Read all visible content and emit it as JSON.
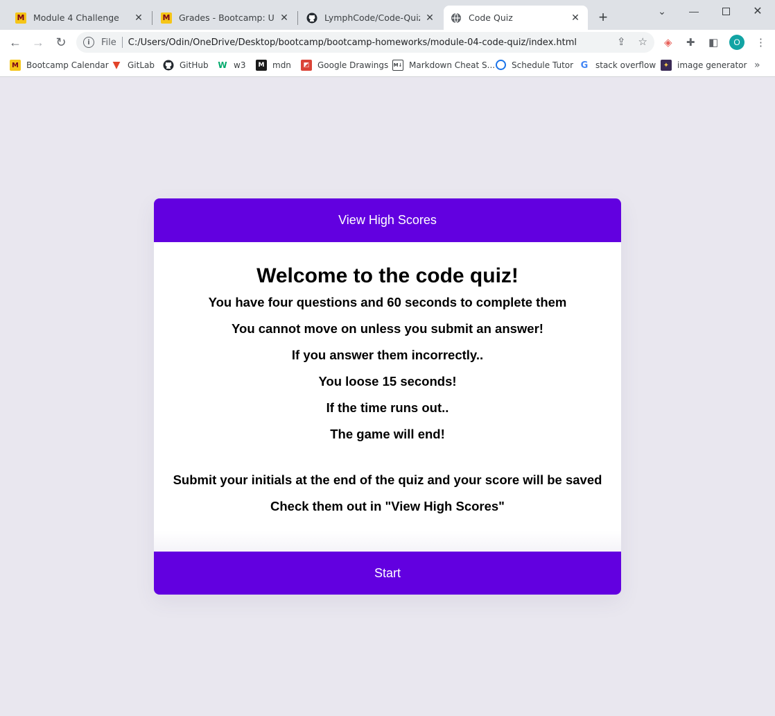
{
  "browser": {
    "tabs": [
      {
        "title": "Module 4 Challenge",
        "favicon": "umn-m-icon"
      },
      {
        "title": "Grades - Bootcamp: UofM-V",
        "favicon": "umn-m-icon"
      },
      {
        "title": "LymphCode/Code-Quiz",
        "favicon": "github-icon"
      },
      {
        "title": "Code Quiz",
        "favicon": "globe-icon"
      }
    ],
    "new_tab_label": "+",
    "address": {
      "scheme_label": "File",
      "url": "C:/Users/Odin/OneDrive/Desktop/bootcamp/bootcamp-homeworks/module-04-code-quiz/index.html"
    },
    "profile_initial": "O",
    "bookmarks": [
      {
        "label": "Bootcamp Calendar",
        "icon": "umn-m-icon"
      },
      {
        "label": "GitLab",
        "icon": "gitlab-icon"
      },
      {
        "label": "GitHub",
        "icon": "github-icon"
      },
      {
        "label": "w3",
        "icon": "w3-icon"
      },
      {
        "label": "mdn",
        "icon": "mdn-icon"
      },
      {
        "label": "Google Drawings",
        "icon": "google-drawings-icon"
      },
      {
        "label": "Markdown Cheat S...",
        "icon": "markdown-icon"
      },
      {
        "label": "Schedule Tutor",
        "icon": "schedule-icon"
      },
      {
        "label": "stack overflow",
        "icon": "google-icon"
      },
      {
        "label": "image generator",
        "icon": "image-gen-icon"
      }
    ],
    "colors": {
      "tab_strip": "#dee1e6",
      "toolbar": "#ffffff",
      "profile": "#12a4a4"
    }
  },
  "quiz": {
    "header_button": "View High Scores",
    "title": "Welcome to the code quiz!",
    "lines": [
      "You have four questions and 60 seconds to complete them",
      "You cannot move on unless you submit an answer!",
      "If you answer them incorrectly..",
      "You loose 15 seconds!",
      "If the time runs out..",
      "The game will end!"
    ],
    "footer_lines": [
      "Submit your initials at the end of the quiz and your score will be saved",
      "Check them out in \"View High Scores\""
    ],
    "start_button": "Start",
    "colors": {
      "accent": "#6200e0",
      "page_background": "#e9e7ef",
      "card": "#ffffff"
    }
  }
}
